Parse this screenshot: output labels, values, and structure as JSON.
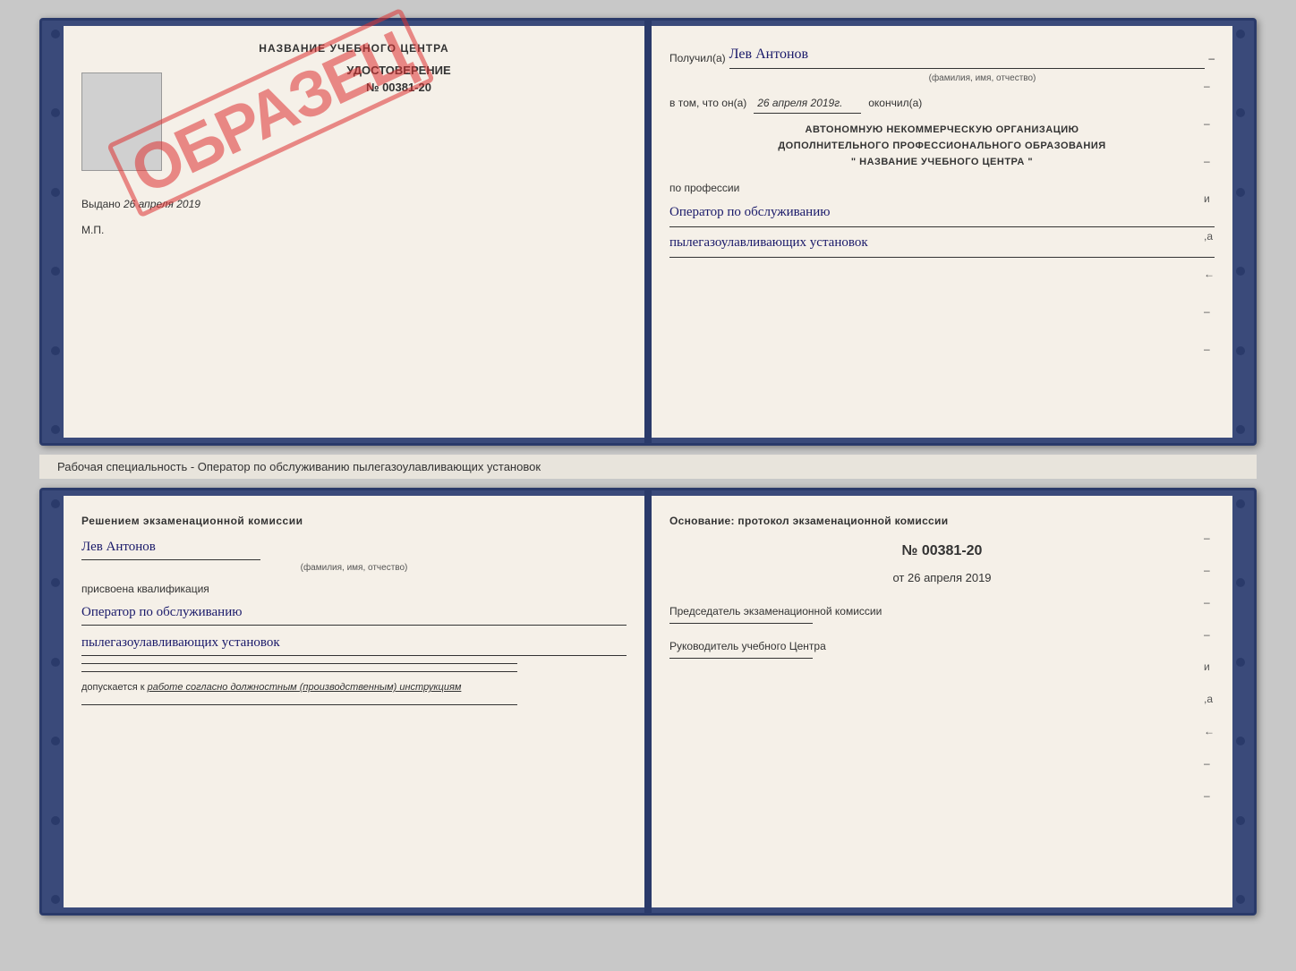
{
  "topBook": {
    "leftPage": {
      "title": "НАЗВАНИЕ УЧЕБНОГО ЦЕНТРА",
      "udostoverenie": "УДОСТОВЕРЕНИЕ",
      "number": "№ 00381-20",
      "vydano_label": "Выдано",
      "vydano_date": "26 апреля 2019",
      "mp": "М.П.",
      "stamp_text": "ОБРАЗЕЦ"
    },
    "rightPage": {
      "poluchil_label": "Получил(а)",
      "recipient_name": "Лев Антонов",
      "fio_label": "(фамилия, имя, отчество)",
      "vtom_label": "в том, что он(а)",
      "date_value": "26 апреля 2019г.",
      "okonchil_label": "окончил(а)",
      "org_line1": "АВТОНОМНУЮ НЕКОММЕРЧЕСКУЮ ОРГАНИЗАЦИЮ",
      "org_line2": "ДОПОЛНИТЕЛЬНОГО ПРОФЕССИОНАЛЬНОГО ОБРАЗОВАНИЯ",
      "org_line3": "\"  НАЗВАНИЕ УЧЕБНОГО ЦЕНТРА  \"",
      "profession_label": "по профессии",
      "profession_line1": "Оператор по обслуживанию",
      "profession_line2": "пылегазоулавливающих установок",
      "right_dashes": [
        "-",
        "-",
        "-",
        "и",
        ",а",
        "←",
        "-",
        "-",
        "-",
        "-"
      ]
    }
  },
  "middleLabel": "Рабочая специальность - Оператор по обслуживанию пылегазоулавливающих установок",
  "bottomBook": {
    "leftPage": {
      "commission_title": "Решением экзаменационной комиссии",
      "person_name": "Лев Антонов",
      "fio_label": "(фамилия, имя, отчество)",
      "qualification_label": "присвоена квалификация",
      "qualification_line1": "Оператор по обслуживанию",
      "qualification_line2": "пылегазоулавливающих установок",
      "dopuskaetsya_label": "допускается к",
      "dopuskaetsya_value": "работе согласно должностным (производственным) инструкциям"
    },
    "rightPage": {
      "osnov_label": "Основание: протокол экзаменационной комиссии",
      "protocol_number": "№  00381-20",
      "ot_label": "от",
      "date_value": "26 апреля 2019",
      "chairman_label": "Председатель экзаменационной комиссии",
      "director_label": "Руководитель учебного Центра",
      "right_dashes": [
        "-",
        "-",
        "-",
        "-",
        "и",
        ",а",
        "←",
        "-",
        "-",
        "-"
      ]
    }
  }
}
